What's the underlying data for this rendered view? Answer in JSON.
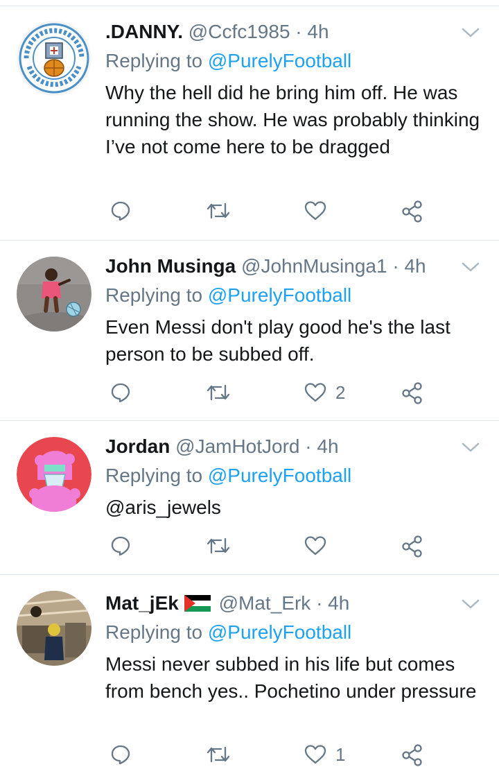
{
  "tweets": [
    {
      "display_name": ".DANNY.",
      "handle": "@Ccfc1985",
      "time": "· 4h",
      "replying_prefix": "Replying to ",
      "replying_to": "@PurelyFootball",
      "text": "Why the hell did he bring him off. He was running the show. He was probably thinking I’ve not come here to be dragged",
      "like_count": "",
      "avatar_text_top": "COVENTRY CITY",
      "avatar_text_bottom": "FOOTBALL CLUB"
    },
    {
      "display_name": "John Musinga",
      "handle": "@JohnMusinga1",
      "time": "· 4h",
      "replying_prefix": "Replying to ",
      "replying_to": "@PurelyFootball",
      "text": "Even Messi don't play good he's the last person to be subbed off.",
      "like_count": "2"
    },
    {
      "display_name": "Jordan",
      "handle": "@JamHotJord",
      "time": "· 4h",
      "replying_prefix": "Replying to ",
      "replying_to": "@PurelyFootball",
      "text": "@aris_jewels",
      "like_count": ""
    },
    {
      "display_name": "Mat_jEk",
      "handle": "@Mat_Erk",
      "time": "· 4h",
      "replying_prefix": "Replying to ",
      "replying_to": "@PurelyFootball",
      "text": "Messi never subbed in his life but comes from bench yes.. Pochetino under pressure",
      "like_count": "1"
    }
  ],
  "icons": {
    "reply": "reply-icon",
    "retweet": "retweet-icon",
    "like": "heart-icon",
    "share": "share-icon",
    "more": "chevron-down-icon"
  },
  "colors": {
    "link": "#1da1f2",
    "secondary_text": "#657786",
    "divider": "#e1e8ed"
  }
}
